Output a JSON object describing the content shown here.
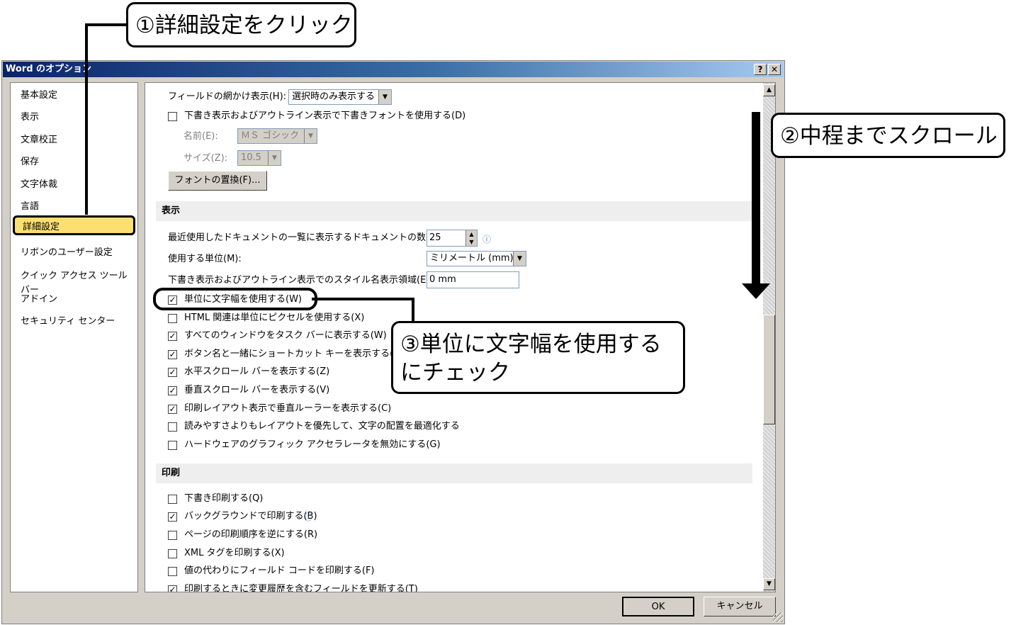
{
  "callouts": {
    "step1": "①詳細設定をクリック",
    "step2": "②中程までスクロール",
    "step3": "③単位に文字幅を使用するにチェック"
  },
  "dialog": {
    "title": "Word のオプション",
    "help_label": "?",
    "close_label": "✕",
    "ok_label": "OK",
    "cancel_label": "キャンセル"
  },
  "nav": {
    "items": [
      {
        "label": "基本設定"
      },
      {
        "label": "表示"
      },
      {
        "label": "文章校正"
      },
      {
        "label": "保存"
      },
      {
        "label": "文字体裁"
      },
      {
        "label": "言語"
      },
      {
        "label": "詳細設定",
        "selected": true
      },
      {
        "label": "リボンのユーザー設定"
      },
      {
        "label": "クイック アクセス ツール バー"
      },
      {
        "label": "アドイン"
      },
      {
        "label": "セキュリティ センター"
      }
    ]
  },
  "content": {
    "field_shading_label": "フィールドの網かけ表示(H):",
    "field_shading_value": "選択時のみ表示する",
    "draft_font_label": "下書き表示およびアウトライン表示で下書きフォントを使用する(D)",
    "name_label": "名前(E):",
    "name_value": "ＭＳ ゴシック",
    "size_label": "サイズ(Z):",
    "size_value": "10.5",
    "font_sub_button": "フォントの置換(F)...",
    "display_section": "表示",
    "recent_docs_label": "最近使用したドキュメントの一覧に表示するドキュメントの数(R):",
    "recent_docs_value": "25",
    "units_label": "使用する単位(M):",
    "units_value": "ミリメートル (mm)",
    "style_area_label": "下書き表示およびアウトライン表示でのスタイル名表示領域(E):",
    "style_area_value": "0 mm",
    "display_checks": [
      {
        "label": "単位に文字幅を使用する(W)",
        "checked": true
      },
      {
        "label": "HTML 関連は単位にピクセルを使用する(X)",
        "checked": false
      },
      {
        "label": "すべてのウィンドウをタスク バーに表示する(W)",
        "checked": true
      },
      {
        "label": "ボタン名と一緒にショートカット キーを表示する(H)",
        "checked": true
      },
      {
        "label": "水平スクロール バーを表示する(Z)",
        "checked": true
      },
      {
        "label": "垂直スクロール バーを表示する(V)",
        "checked": true
      },
      {
        "label": "印刷レイアウト表示で垂直ルーラーを表示する(C)",
        "checked": true
      },
      {
        "label": "読みやすさよりもレイアウトを優先して、文字の配置を最適化する",
        "checked": false
      },
      {
        "label": "ハードウェアのグラフィック アクセラレータを無効にする(G)",
        "checked": false
      }
    ],
    "print_section": "印刷",
    "print_checks": [
      {
        "label": "下書き印刷する(Q)",
        "checked": false
      },
      {
        "label": "バックグラウンドで印刷する(B)",
        "checked": true
      },
      {
        "label": "ページの印刷順序を逆にする(R)",
        "checked": false
      },
      {
        "label": "XML タグを印刷する(X)",
        "checked": false
      },
      {
        "label": "値の代わりにフィールド コードを印刷する(F)",
        "checked": false
      },
      {
        "label": "印刷するときに変更履歴を含むフィールドを更新する(T)",
        "checked": true
      }
    ]
  }
}
